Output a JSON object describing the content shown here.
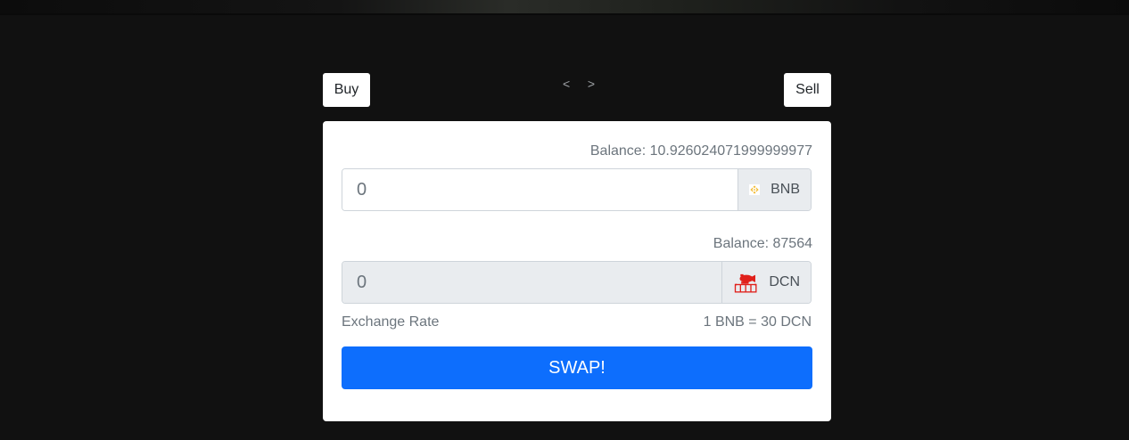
{
  "buttons": {
    "buy_label": "Buy",
    "sell_label": "Sell",
    "prev_label": "<",
    "next_label": ">",
    "swap_label": "SWAP!"
  },
  "from": {
    "balance_text": "Balance: 10.926024071999999977",
    "placeholder": "0",
    "token_symbol": "BNB",
    "token_icon": "bnb-logo-icon"
  },
  "to": {
    "balance_text": "Balance: 87564",
    "placeholder": "0",
    "token_symbol": "DCN",
    "token_icon": "dcn-logo-icon"
  },
  "exchange": {
    "label": "Exchange Rate",
    "value": "1 BNB = 30 DCN"
  },
  "colors": {
    "background": "#111111",
    "accent": "#0d6efd",
    "bnb": "#F3BA2F",
    "dcn": "#E0201B"
  }
}
